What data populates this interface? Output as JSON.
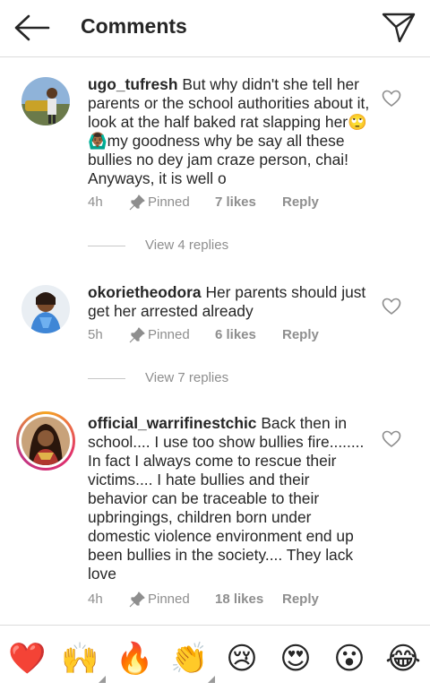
{
  "header": {
    "title": "Comments",
    "back_icon": "arrow-left-icon",
    "send_icon": "paper-plane-icon"
  },
  "comments": [
    {
      "username": "ugo_tufresh",
      "text": "But why didn't she tell her parents or the school authorities about it, look at the half baked rat slapping her🙄🙆🏾‍♂️my goodness why be say all these bullies no dey jam craze person, chai! Anyways, it is well o",
      "time": "4h",
      "pinned": "Pinned",
      "likes": "7 likes",
      "reply": "Reply",
      "view_replies": "View 4 replies"
    },
    {
      "username": "okorietheodora",
      "text": "Her parents should just get her arrested already",
      "time": "5h",
      "pinned": "Pinned",
      "likes": "6 likes",
      "reply": "Reply",
      "view_replies": "View 7 replies"
    },
    {
      "username": "official_warrifinestchic",
      "text": "Back then in school.... I use too show bullies fire........ In fact I always come to rescue their victims.... I hate bullies and their behavior can be traceable to their upbringings, children born under domestic violence environment end up been bullies in the society.... They lack love",
      "time": "4h",
      "pinned": "Pinned",
      "likes": "18 likes",
      "reply": "Reply"
    }
  ],
  "emoji_bar": [
    {
      "glyph": "❤️",
      "name": "red-heart"
    },
    {
      "glyph": "🙌",
      "name": "raising-hands"
    },
    {
      "glyph": "🔥",
      "name": "fire"
    },
    {
      "glyph": "👏",
      "name": "clapping-hands"
    },
    {
      "glyph": "😢",
      "name": "crying-face"
    },
    {
      "glyph": "😍",
      "name": "heart-eyes"
    },
    {
      "glyph": "😮",
      "name": "open-mouth"
    },
    {
      "glyph": "😂",
      "name": "tears-of-joy"
    }
  ],
  "colors": {
    "text": "#262626",
    "secondary": "#8e8e8e",
    "divider": "#dbdbdb"
  }
}
